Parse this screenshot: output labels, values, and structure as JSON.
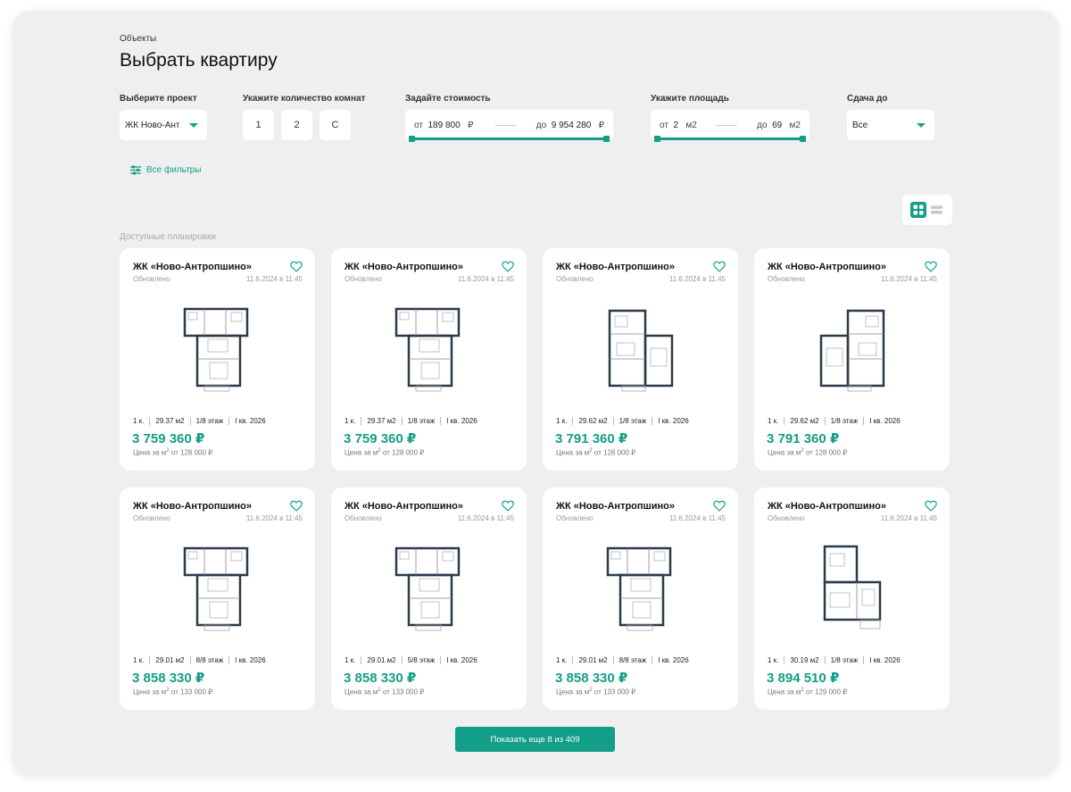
{
  "breadcrumb": "Объекты",
  "title": "Выбрать квартиру",
  "filters": {
    "project": {
      "label": "Выберите проект",
      "value": "ЖК Ново-Ант"
    },
    "rooms": {
      "label": "Укажите количество комнат",
      "options": [
        "1",
        "2",
        "С"
      ]
    },
    "price": {
      "label": "Задайте стоимость",
      "from_prefix": "от",
      "from": "189 800",
      "to_prefix": "до",
      "to": "9 954 280",
      "unit": "₽"
    },
    "area": {
      "label": "Укажите площадь",
      "from_prefix": "от",
      "from": "2",
      "to_prefix": "до",
      "to": "69",
      "unit": "м2"
    },
    "delivery": {
      "label": "Сдача до",
      "value": "Все"
    },
    "all_filters": "Все фильтры"
  },
  "available_label": "Доступные планировки",
  "cards": [
    {
      "title": "ЖК «Ново-Антропшино»",
      "updated": "Обновлено",
      "date": "11.6.2024 в 11:45",
      "rooms": "1 к.",
      "area": "29.37 м2",
      "floor": "1/8 этаж",
      "delivery": "I кв. 2026",
      "price": "3 759 360 ₽",
      "ppm_prefix": "Цена за м",
      "ppm_value": "от 128 000 ₽"
    },
    {
      "title": "ЖК «Ново-Антропшино»",
      "updated": "Обновлено",
      "date": "11.6.2024 в 11:45",
      "rooms": "1 к.",
      "area": "29.37 м2",
      "floor": "1/8 этаж",
      "delivery": "I кв. 2026",
      "price": "3 759 360 ₽",
      "ppm_prefix": "Цена за м",
      "ppm_value": "от 128 000 ₽"
    },
    {
      "title": "ЖК «Ново-Антропшино»",
      "updated": "Обновлено",
      "date": "11.6.2024 в 11:45",
      "rooms": "1 к.",
      "area": "29.62 м2",
      "floor": "1/8 этаж",
      "delivery": "I кв. 2026",
      "price": "3 791 360 ₽",
      "ppm_prefix": "Цена за м",
      "ppm_value": "от 128 000 ₽"
    },
    {
      "title": "ЖК «Ново-Антропшино»",
      "updated": "Обновлено",
      "date": "11.6.2024 в 11:45",
      "rooms": "1 к.",
      "area": "29.62 м2",
      "floor": "1/8 этаж",
      "delivery": "I кв. 2026",
      "price": "3 791 360 ₽",
      "ppm_prefix": "Цена за м",
      "ppm_value": "от 128 000 ₽"
    },
    {
      "title": "ЖК «Ново-Антропшино»",
      "updated": "Обновлено",
      "date": "11.6.2024 в 11:45",
      "rooms": "1 к.",
      "area": "29.01 м2",
      "floor": "8/8 этаж",
      "delivery": "I кв. 2026",
      "price": "3 858 330 ₽",
      "ppm_prefix": "Цена за м",
      "ppm_value": "от 133 000 ₽"
    },
    {
      "title": "ЖК «Ново-Антропшино»",
      "updated": "Обновлено",
      "date": "11.6.2024 в 11:45",
      "rooms": "1 к.",
      "area": "29.01 м2",
      "floor": "5/8 этаж",
      "delivery": "I кв. 2026",
      "price": "3 858 330 ₽",
      "ppm_prefix": "Цена за м",
      "ppm_value": "от 133 000 ₽"
    },
    {
      "title": "ЖК «Ново-Антропшино»",
      "updated": "Обновлено",
      "date": "11.6.2024 в 11:45",
      "rooms": "1 к.",
      "area": "29.01 м2",
      "floor": "8/8 этаж",
      "delivery": "I кв. 2026",
      "price": "3 858 330 ₽",
      "ppm_prefix": "Цена за м",
      "ppm_value": "от 133 000 ₽"
    },
    {
      "title": "ЖК «Ново-Антропшино»",
      "updated": "Обновлено",
      "date": "11.6.2024 в 11:45",
      "rooms": "1 к.",
      "area": "30.19 м2",
      "floor": "1/8 этаж",
      "delivery": "I кв. 2026",
      "price": "3 894 510 ₽",
      "ppm_prefix": "Цена за м",
      "ppm_value": "от 129 000 ₽"
    }
  ],
  "show_more": "Показать еще 8 из 409",
  "accent_color": "#139e88",
  "icons": {
    "favorite": "heart-outline-icon",
    "filters": "sliders-icon",
    "grid": "grid-view-icon",
    "list": "list-view-icon",
    "dropdown": "caret-down-icon"
  }
}
